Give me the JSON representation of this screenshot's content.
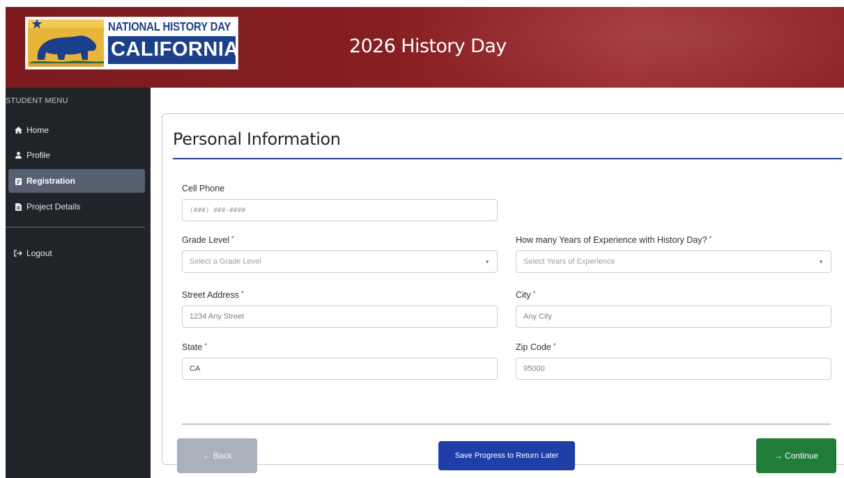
{
  "header": {
    "logo_line1": "NATIONAL HISTORY DAY",
    "logo_line2": "CALIFORNIA",
    "title": "2026 History Day"
  },
  "sidebar": {
    "heading": "STUDENT MENU",
    "items": [
      {
        "label": "Home",
        "icon": "home-icon",
        "active": false
      },
      {
        "label": "Profile",
        "icon": "user-icon",
        "active": false
      },
      {
        "label": "Registration",
        "icon": "clipboard-icon",
        "active": true
      },
      {
        "label": "Project Details",
        "icon": "document-icon",
        "active": false
      }
    ],
    "logout": {
      "label": "Logout",
      "icon": "logout-icon"
    }
  },
  "form": {
    "title": "Personal Information",
    "cell_phone": {
      "label": "Cell Phone",
      "placeholder": "(###) ###-####",
      "required": false
    },
    "grade_level": {
      "label": "Grade Level",
      "placeholder": "Select a Grade Level",
      "required": true
    },
    "years_experience": {
      "label": "How many Years of Experience with History Day?",
      "placeholder": "Select Years of Experience",
      "required": true
    },
    "street_address": {
      "label": "Street Address",
      "placeholder": "1234 Any Street",
      "required": true
    },
    "city": {
      "label": "City",
      "placeholder": "Any City",
      "required": true
    },
    "state": {
      "label": "State",
      "value": "CA",
      "required": true
    },
    "zip_code": {
      "label": "Zip Code",
      "placeholder": "95000",
      "required": true
    },
    "required_marker": "*"
  },
  "buttons": {
    "back": "← Back",
    "save": "Save Progress to Return Later",
    "continue": "→ Continue"
  },
  "colors": {
    "header_red": "#861f23",
    "sidebar_bg": "#202327",
    "active_item": "#566071",
    "title_rule": "#223f95",
    "save_blue": "#1f3ea8",
    "continue_green": "#1f7c39",
    "back_gray": "#a9b1bc",
    "required_red": "#d9362f"
  }
}
